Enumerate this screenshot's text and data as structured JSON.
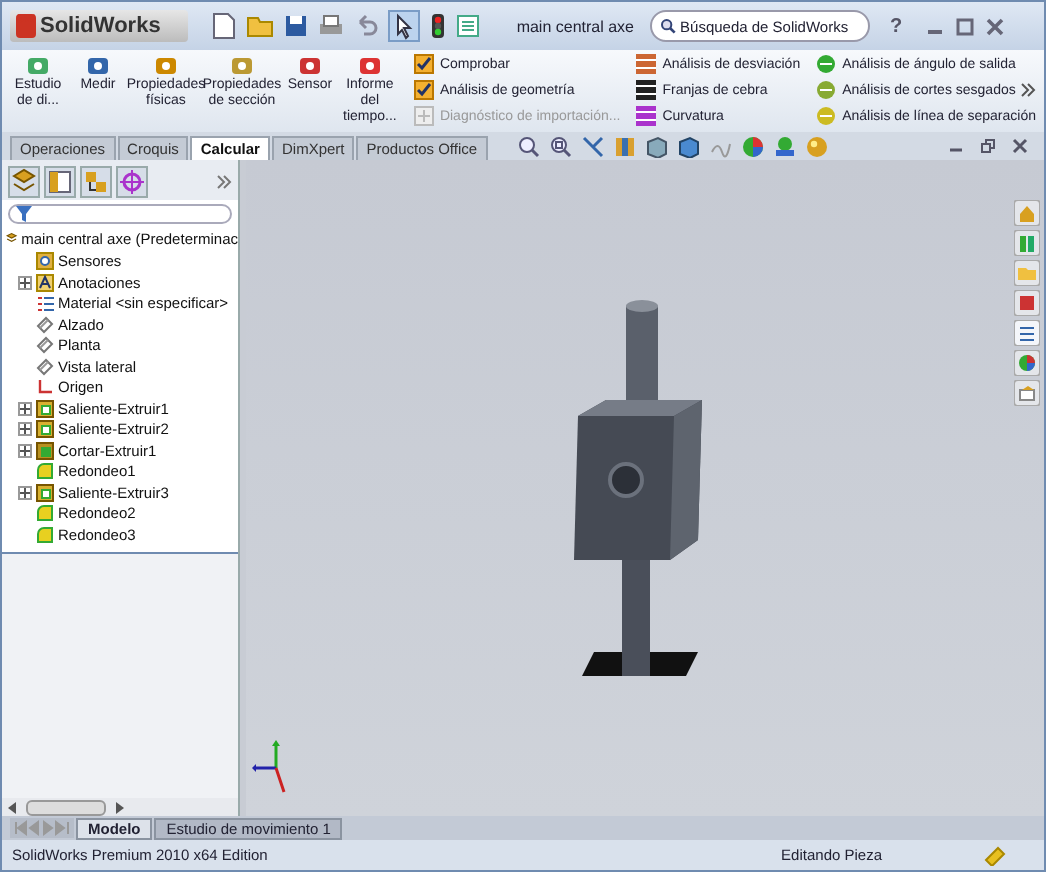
{
  "window": {
    "logo": "SolidWorks",
    "title": "main central axe",
    "search_placeholder": "Búsqueda de SolidWorks",
    "help": "?"
  },
  "ribbon": {
    "large_buttons": [
      {
        "label": "Estudio de di...",
        "kind": "study"
      },
      {
        "label": "Medir",
        "kind": "measure"
      },
      {
        "label": "Propiedades físicas",
        "kind": "scale"
      },
      {
        "label": "Propiedades de sección",
        "kind": "section"
      },
      {
        "label": "Sensor",
        "kind": "sensor"
      },
      {
        "label": "Informe del tiempo...",
        "kind": "report"
      }
    ],
    "checks": [
      {
        "label": "Comprobar",
        "disabled": false
      },
      {
        "label": "Análisis de geometría",
        "disabled": false
      },
      {
        "label": "Diagnóstico de importación...",
        "disabled": true
      }
    ],
    "analysis_col1": [
      {
        "label": "Análisis de desviación",
        "kind": "deviation"
      },
      {
        "label": "Franjas de cebra",
        "kind": "zebra"
      },
      {
        "label": "Curvatura",
        "kind": "curvature"
      }
    ],
    "analysis_col2": [
      {
        "label": "Análisis de ángulo de salida",
        "kind": "draft"
      },
      {
        "label": "Análisis de cortes sesgados",
        "kind": "undercut"
      },
      {
        "label": "Análisis de línea de separación",
        "kind": "parting"
      }
    ]
  },
  "tabs": [
    {
      "label": "Operaciones",
      "selected": false
    },
    {
      "label": "Croquis",
      "selected": false
    },
    {
      "label": "Calcular",
      "selected": true
    },
    {
      "label": "DimXpert",
      "selected": false
    },
    {
      "label": "Productos Office",
      "selected": false
    }
  ],
  "tree": {
    "root": "main central axe  (Predeterminac",
    "items": [
      {
        "label": "Sensores",
        "kind": "sensor",
        "collapsed": false
      },
      {
        "label": "Anotaciones",
        "kind": "annotation",
        "collapsed": true
      },
      {
        "label": "Material <sin especificar>",
        "kind": "material",
        "collapsed": false
      },
      {
        "label": "Alzado",
        "kind": "plane",
        "collapsed": false
      },
      {
        "label": "Planta",
        "kind": "plane",
        "collapsed": false
      },
      {
        "label": "Vista lateral",
        "kind": "plane",
        "collapsed": false
      },
      {
        "label": "Origen",
        "kind": "origin",
        "collapsed": false
      },
      {
        "label": "Saliente-Extruir1",
        "kind": "feature",
        "collapsed": true
      },
      {
        "label": "Saliente-Extruir2",
        "kind": "feature",
        "collapsed": true
      },
      {
        "label": "Cortar-Extruir1",
        "kind": "cut",
        "collapsed": true
      },
      {
        "label": "Redondeo1",
        "kind": "fillet",
        "collapsed": false
      },
      {
        "label": "Saliente-Extruir3",
        "kind": "feature",
        "collapsed": true
      },
      {
        "label": "Redondeo2",
        "kind": "fillet",
        "collapsed": false
      },
      {
        "label": "Redondeo3",
        "kind": "fillet",
        "collapsed": false
      }
    ]
  },
  "bottom_tabs": [
    {
      "label": "Modelo",
      "selected": true
    },
    {
      "label": "Estudio de movimiento 1",
      "selected": false
    }
  ],
  "status_bar": {
    "product": "SolidWorks Premium 2010 x64 Edition",
    "mode": "Editando Pieza"
  }
}
